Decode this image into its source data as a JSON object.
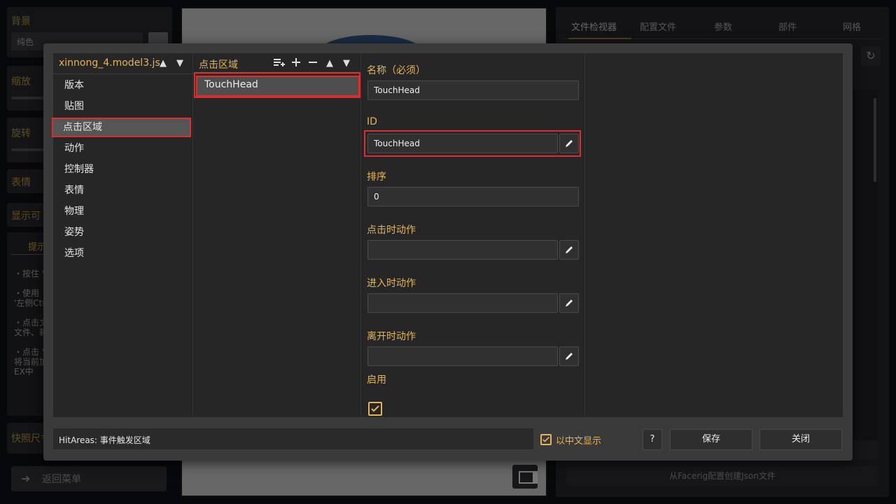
{
  "background": {
    "left": {
      "bg_label": "背景",
      "bg_select": "纯色",
      "zoom_label": "缩放",
      "rotate_label": "旋转",
      "expression_label": "表情",
      "display_label": "显示可",
      "tips_tab": "提示",
      "tips": [
        "・按住 '",
        "・使用",
        "'左侧Ctr",
        "・点击文",
        "文件、新",
        "・点击 '",
        "将当前加",
        "EX中"
      ],
      "snapshot_label": "快照尺寸",
      "return_label": "返回菜单"
    },
    "right": {
      "tabs": [
        "文件检视器",
        "配置文件",
        "参数",
        "部件",
        "网格"
      ],
      "footer_button": "从Facerig配置创建Json文件"
    }
  },
  "modal": {
    "file_name": "xinnong_4.model3.js",
    "nav_items": [
      "版本",
      "贴图",
      "点击区域",
      "动作",
      "控制器",
      "表情",
      "物理",
      "姿势",
      "选项"
    ],
    "selected_nav": "点击区域",
    "list_title": "点击区域",
    "list_items": [
      "TouchHead"
    ],
    "fields": {
      "name_label": "名称（必须）",
      "name_value": "TouchHead",
      "id_label": "ID",
      "id_value": "TouchHead",
      "order_label": "排序",
      "order_value": "0",
      "tap_motion_label": "点击时动作",
      "tap_motion_value": "",
      "enter_motion_label": "进入时动作",
      "enter_motion_value": "",
      "leave_motion_label": "离开时动作",
      "leave_motion_value": "",
      "enabled_label": "启用",
      "enabled": true
    },
    "footer": {
      "description": "HitAreas: 事件触发区域",
      "show_chinese_label": "以中文显示",
      "show_chinese": true,
      "help_label": "?",
      "save_label": "保存",
      "close_label": "关闭"
    }
  },
  "colors": {
    "accent": "#e3b45a",
    "highlight": "#d9302f"
  }
}
